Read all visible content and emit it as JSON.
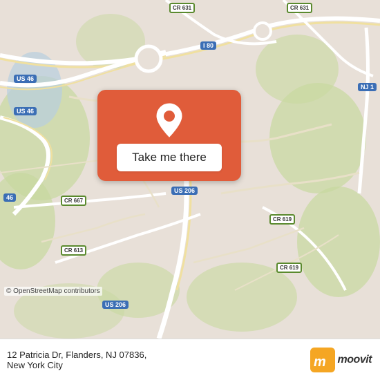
{
  "map": {
    "center": "12 Patricia Dr, Flanders, NJ 07836",
    "attribution": "© OpenStreetMap contributors"
  },
  "button": {
    "label": "Take me there"
  },
  "address": {
    "street": "12 Patricia Dr, Flanders, NJ 07836,",
    "city": "New York City"
  },
  "branding": {
    "name": "moovit"
  },
  "road_labels": [
    {
      "id": "us46_top_left",
      "text": "US 46",
      "type": "highway"
    },
    {
      "id": "us46_mid_left",
      "text": "US 46",
      "type": "highway"
    },
    {
      "id": "us46_left",
      "text": "46",
      "type": "highway"
    },
    {
      "id": "i80",
      "text": "I 80",
      "type": "highway"
    },
    {
      "id": "cr631_top",
      "text": "CR 631",
      "type": "cr"
    },
    {
      "id": "cr631_right",
      "text": "CR 631",
      "type": "cr"
    },
    {
      "id": "cr667",
      "text": "CR 667",
      "type": "cr"
    },
    {
      "id": "cr613",
      "text": "CR 613",
      "type": "cr"
    },
    {
      "id": "cr619_mid",
      "text": "CR 619",
      "type": "cr"
    },
    {
      "id": "cr619_bot",
      "text": "CR 619",
      "type": "cr"
    },
    {
      "id": "us206_mid",
      "text": "US 206",
      "type": "highway"
    },
    {
      "id": "us206_bot",
      "text": "US 206",
      "type": "highway"
    },
    {
      "id": "nj_right",
      "text": "NJ 1",
      "type": "highway"
    }
  ],
  "colors": {
    "map_bg": "#e8e0d8",
    "green_area": "#c8d8a0",
    "road_main": "#ffffff",
    "road_secondary": "#f0e8c0",
    "water": "#b8d4e8",
    "pin_bg": "#e05c3a",
    "button_bg": "#ffffff",
    "bottom_bar": "#ffffff",
    "highway_sign": "#3b6eb5"
  }
}
